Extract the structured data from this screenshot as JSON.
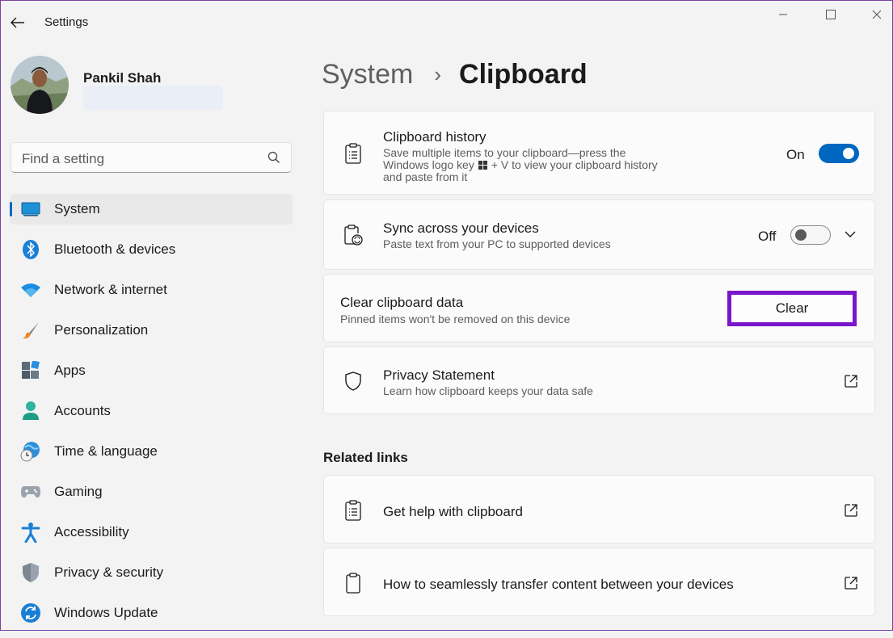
{
  "window": {
    "title": "Settings"
  },
  "user": {
    "name": "Pankil Shah"
  },
  "search": {
    "placeholder": "Find a setting"
  },
  "sidebar": {
    "items": [
      {
        "label": "System",
        "icon": "system-icon",
        "active": true
      },
      {
        "label": "Bluetooth & devices",
        "icon": "bluetooth-icon"
      },
      {
        "label": "Network & internet",
        "icon": "wifi-icon"
      },
      {
        "label": "Personalization",
        "icon": "brush-icon"
      },
      {
        "label": "Apps",
        "icon": "apps-icon"
      },
      {
        "label": "Accounts",
        "icon": "account-icon"
      },
      {
        "label": "Time & language",
        "icon": "globe-clock-icon"
      },
      {
        "label": "Gaming",
        "icon": "gamepad-icon"
      },
      {
        "label": "Accessibility",
        "icon": "accessibility-icon"
      },
      {
        "label": "Privacy & security",
        "icon": "shield-icon"
      },
      {
        "label": "Windows Update",
        "icon": "update-icon"
      }
    ]
  },
  "breadcrumb": {
    "parent": "System",
    "separator": "›",
    "current": "Clipboard"
  },
  "cards": {
    "history": {
      "title": "Clipboard history",
      "line1": "Save multiple items to your clipboard—press the",
      "line2a": "Windows logo key",
      "line2b": "+ V to view your clipboard history",
      "line3": "and paste from it",
      "state": "On"
    },
    "sync": {
      "title": "Sync across your devices",
      "subtitle": "Paste text from your PC to supported devices",
      "state": "Off"
    },
    "clear": {
      "title": "Clear clipboard data",
      "subtitle": "Pinned items won't be removed on this device",
      "button": "Clear"
    },
    "privacy": {
      "title": "Privacy Statement",
      "subtitle": "Learn how clipboard keeps your data safe"
    }
  },
  "related": {
    "heading": "Related links",
    "links": [
      {
        "label": "Get help with clipboard"
      },
      {
        "label": "How to seamlessly transfer content between your devices"
      }
    ]
  },
  "colors": {
    "accent": "#0067c0",
    "highlight_border": "#7a16c9",
    "background": "#f3f3f3"
  }
}
